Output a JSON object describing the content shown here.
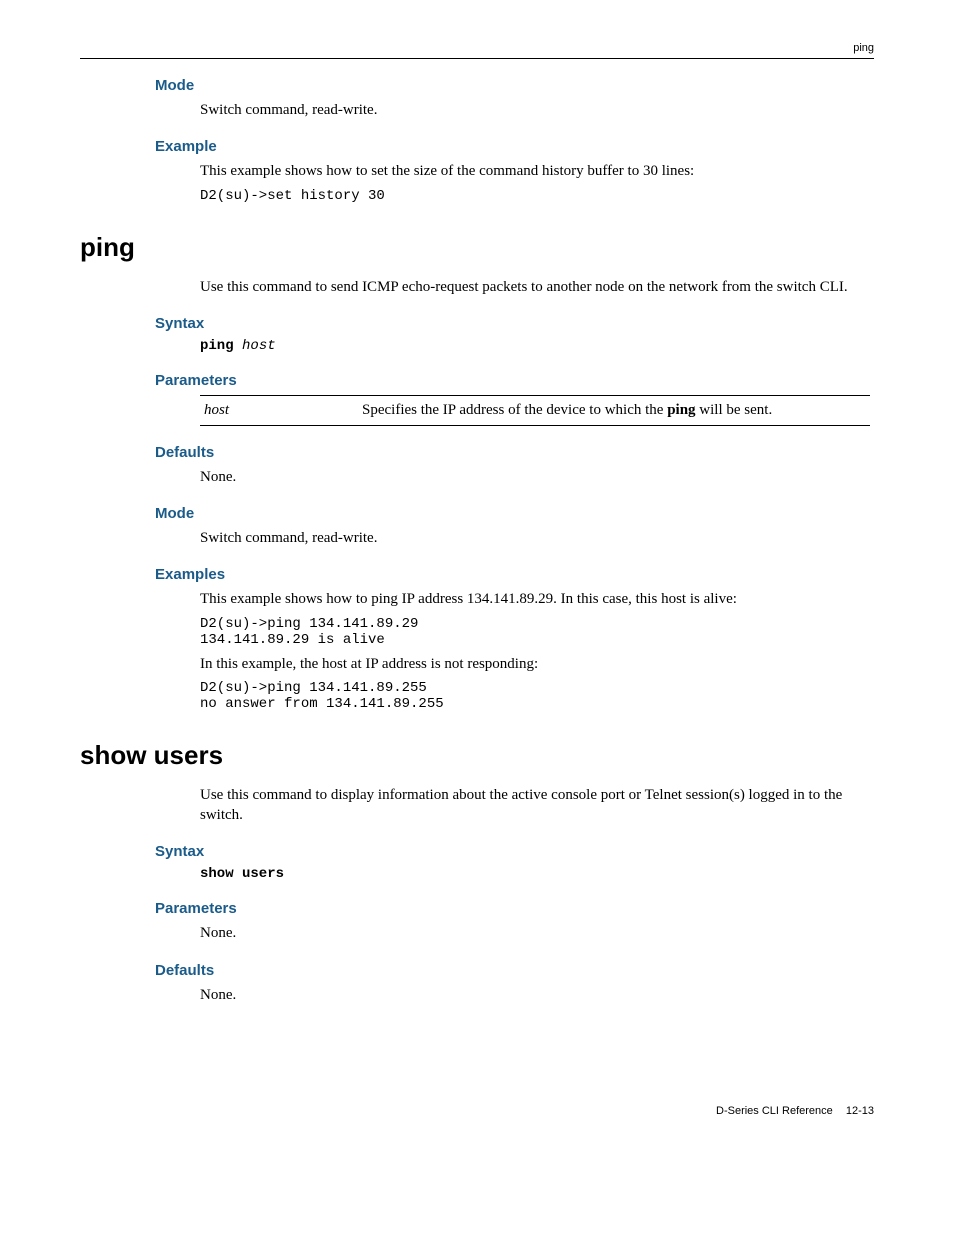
{
  "running_head": "ping",
  "sec1": {
    "mode_h": "Mode",
    "mode_t": "Switch command, read-write.",
    "ex_h": "Example",
    "ex_t": "This example shows how to set the size of the command history buffer to 30 lines:",
    "ex_code": "D2(su)->set history 30"
  },
  "ping": {
    "title": "ping",
    "intro": "Use this command to send ICMP echo-request packets to another node on the network from the switch CLI.",
    "syntax_h": "Syntax",
    "syntax_cmd": "ping",
    "syntax_arg": "host",
    "params_h": "Parameters",
    "param_name": "host",
    "param_desc_a": "Specifies the IP address of the device to which the ",
    "param_desc_bold": "ping",
    "param_desc_b": " will be sent.",
    "defaults_h": "Defaults",
    "defaults_t": "None.",
    "mode_h": "Mode",
    "mode_t": "Switch command, read-write.",
    "ex_h": "Examples",
    "ex1_t": "This example shows how to ping IP address 134.141.89.29. In this case, this host is alive:",
    "ex1_code": "D2(su)->ping 134.141.89.29\n134.141.89.29 is alive",
    "ex2_t": "In this example, the host at IP address is not responding:",
    "ex2_code": "D2(su)->ping 134.141.89.255\nno answer from 134.141.89.255"
  },
  "showusers": {
    "title": "show users",
    "intro": "Use this command to display information about the active console port or Telnet session(s) logged in to the switch.",
    "syntax_h": "Syntax",
    "syntax_cmd": "show users",
    "params_h": "Parameters",
    "params_t": "None.",
    "defaults_h": "Defaults",
    "defaults_t": "None."
  },
  "footer": {
    "doc": "D-Series CLI Reference",
    "page": "12-13"
  }
}
